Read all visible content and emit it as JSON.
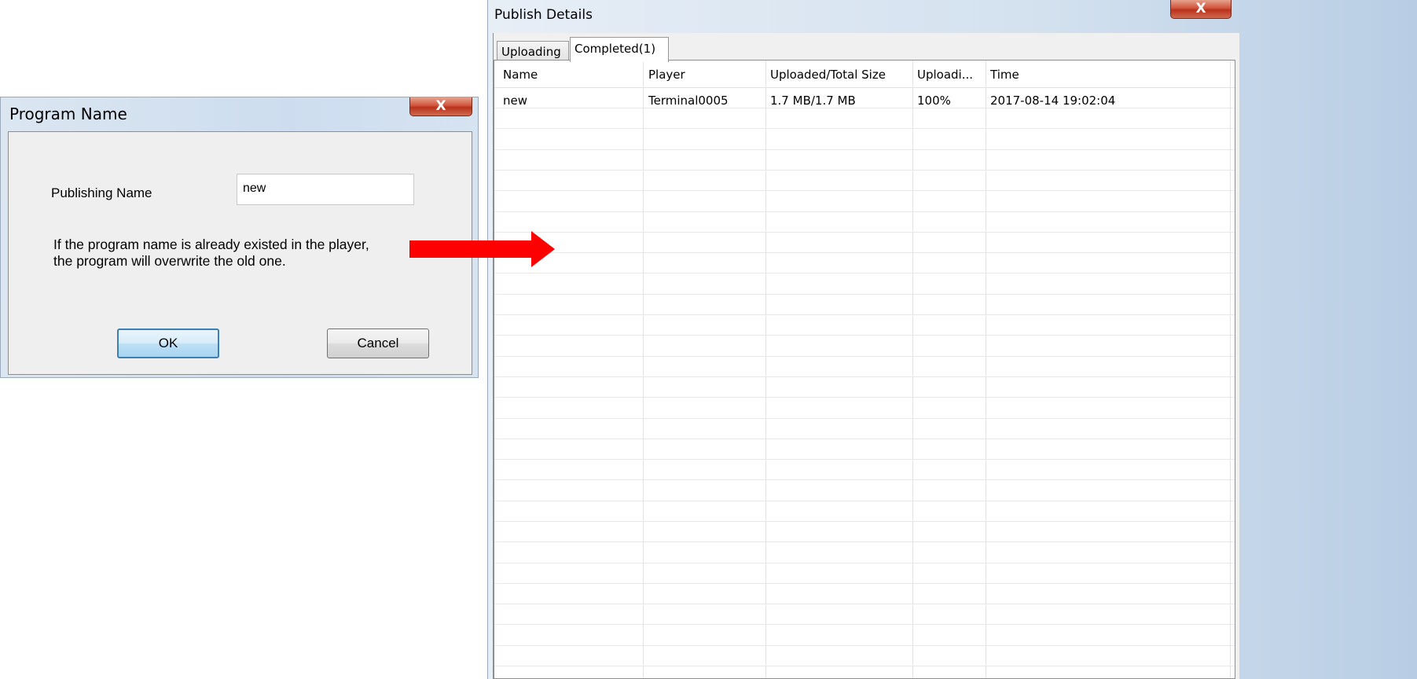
{
  "program_dialog": {
    "title": "Program Name",
    "close_glyph": "X",
    "publishing_name_label": "Publishing Name",
    "publishing_name_value": "new",
    "warning_line1": "If the program name is already existed in the player,",
    "warning_line2": "the program will overwrite the old one.",
    "ok_label": "OK",
    "cancel_label": "Cancel"
  },
  "publish_window": {
    "title": "Publish Details",
    "close_glyph": "X",
    "tabs": [
      {
        "label": "Uploading",
        "active": false
      },
      {
        "label": "Completed(1)",
        "active": true
      }
    ],
    "columns": [
      "Name",
      "Player",
      "Uploaded/Total Size",
      "Uploadi...",
      "Time"
    ],
    "rows": [
      {
        "name": "new",
        "player": "Terminal0005",
        "size": "1.7 MB/1.7 MB",
        "progress": "100%",
        "time": "2017-08-14 19:02:04"
      }
    ]
  },
  "colors": {
    "arrow": "#ff0000",
    "close_button": "#c8452d",
    "ok_border": "#3c7fb1"
  },
  "icons": {
    "arrow": "right-arrow-icon"
  }
}
